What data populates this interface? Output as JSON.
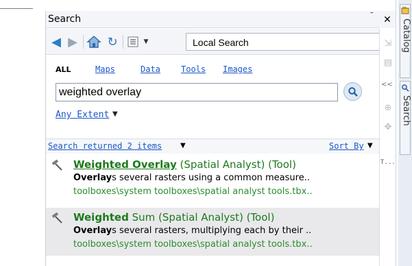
{
  "window": {
    "title": "Search"
  },
  "toolbar": {
    "scope_label": "Local Search"
  },
  "filters": [
    {
      "label": "ALL",
      "active": true
    },
    {
      "label": "Maps",
      "active": false
    },
    {
      "label": "Data",
      "active": false
    },
    {
      "label": "Tools",
      "active": false
    },
    {
      "label": "Images",
      "active": false
    }
  ],
  "search": {
    "query": "weighted overlay",
    "extent_label": "Any Extent"
  },
  "results_header": {
    "count_label": "Search returned 2 items",
    "sort_label": "Sort By"
  },
  "results": [
    {
      "name": "Weighted Overlay",
      "rest": " (Spatial Analyst) (Tool)",
      "desc_bold": "Overlay",
      "desc_rest": "s several rasters using a common measure..",
      "path": "toolboxes\\system toolboxes\\spatial analyst tools.tbx.."
    },
    {
      "name": "Weighted",
      "rest": " Sum (Spatial Analyst) (Tool)",
      "desc_bold": "Overlay",
      "desc_rest": "s several rasters, multiplying each by their ..",
      "path": "toolboxes\\system toolboxes\\spatial analyst tools.tbx.."
    }
  ],
  "side": {
    "collapse_label": "<<",
    "tab_label": "T..."
  },
  "dock_tabs": [
    {
      "label": "Catalog"
    },
    {
      "label": "Search"
    }
  ],
  "colors": {
    "link": "#1a56c9",
    "result_green": "#1d7a1d",
    "selected_row": "#e9e9eb"
  }
}
